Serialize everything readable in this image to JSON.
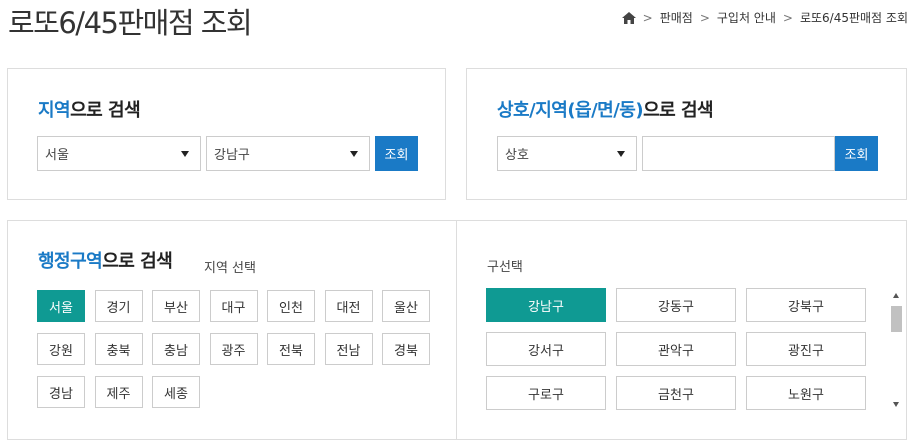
{
  "page": {
    "title": "로또6/45판매점 조회"
  },
  "breadcrumb": {
    "items": [
      "판매점",
      "구입처 안내",
      "로또6/45판매점 조회"
    ]
  },
  "region_search": {
    "title_highlight": "지역",
    "title_rest": "으로 검색",
    "city_select": "서울",
    "district_select": "강남구",
    "button": "조회"
  },
  "shop_search": {
    "title_highlight": "상호/지역(읍/면/동)",
    "title_rest": "으로 검색",
    "type_select": "상호",
    "input_value": "",
    "button": "조회"
  },
  "admin_search": {
    "title_highlight": "행정구역",
    "title_rest": "으로 검색",
    "region_label": "지역 선택",
    "regions": [
      "서울",
      "경기",
      "부산",
      "대구",
      "인천",
      "대전",
      "울산",
      "강원",
      "충북",
      "충남",
      "광주",
      "전북",
      "전남",
      "경북",
      "경남",
      "제주",
      "세종"
    ],
    "selected_region": "서울",
    "district_label": "구선택",
    "districts": [
      "강남구",
      "강동구",
      "강북구",
      "강서구",
      "관악구",
      "광진구",
      "구로구",
      "금천구",
      "노원구"
    ],
    "selected_district": "강남구"
  },
  "colors": {
    "accent_blue": "#1a7ac6",
    "accent_teal": "#0f9a93"
  }
}
